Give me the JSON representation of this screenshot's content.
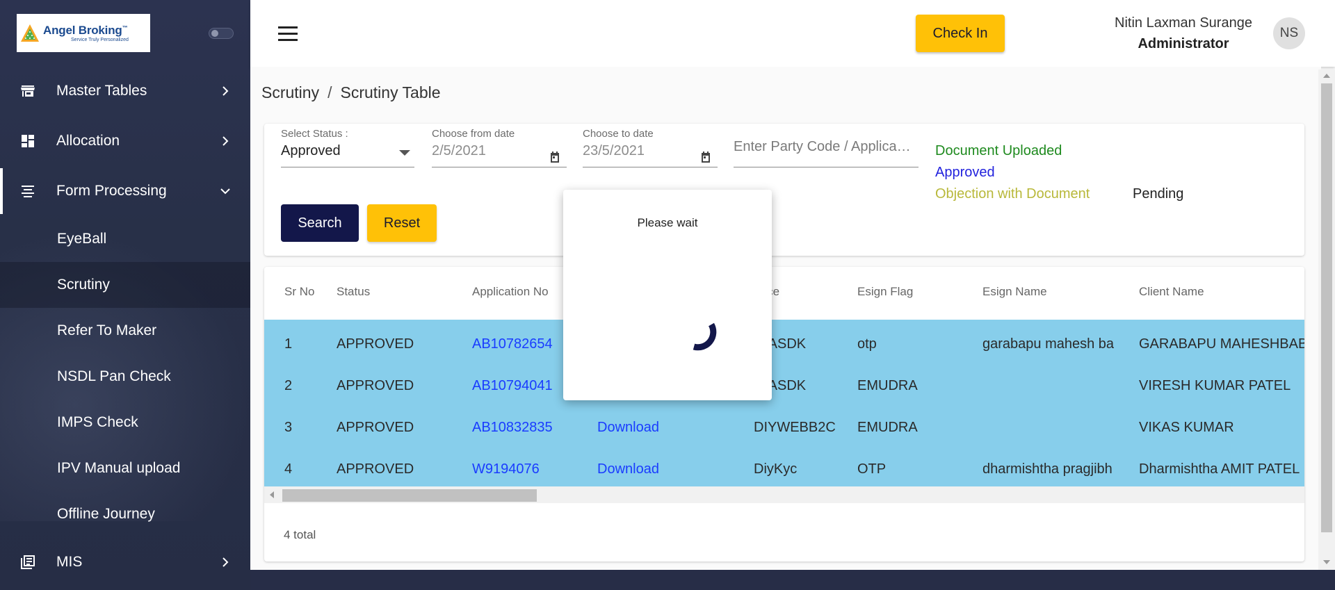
{
  "colors": {
    "sidebar_bg": "#283048",
    "accent_yellow": "#ffc107",
    "navy_button": "#13174a",
    "row_highlight": "#87ceeb",
    "link_blue": "#1a3cff",
    "legend_document_uploaded": "#1e8a1e",
    "legend_approved": "#2222dd",
    "legend_objection": "#b8b83a",
    "legend_pending": "#222222"
  },
  "brand": {
    "name": "Angel Broking",
    "tm": "™",
    "tagline": "Service Truly Personalized"
  },
  "sidebar": {
    "items": [
      {
        "label": "Master Tables",
        "icon": "store-icon",
        "chevron": "chevron-right-icon"
      },
      {
        "label": "Allocation",
        "icon": "dashboard-icon",
        "chevron": "chevron-right-icon"
      },
      {
        "label": "Form Processing",
        "icon": "subject-icon",
        "chevron": "chevron-down-icon"
      },
      {
        "label": "MIS",
        "icon": "library-books-icon",
        "chevron": "chevron-right-icon"
      }
    ],
    "subitems": [
      "EyeBall",
      "Scrutiny",
      "Refer To Maker",
      "NSDL Pan Check",
      "IMPS Check",
      "IPV Manual upload",
      "Offline Journey"
    ]
  },
  "header": {
    "checkin_label": "Check In",
    "user_name": "Nitin Laxman Surange",
    "user_role": "Administrator",
    "avatar_initials": "NS"
  },
  "breadcrumb": {
    "parent": "Scrutiny",
    "separator": "/",
    "current": "Scrutiny Table"
  },
  "filters": {
    "status_label": "Select Status :",
    "status_value": "Approved",
    "from_label": "Choose from date",
    "from_value": "2/5/2021",
    "to_label": "Choose to date",
    "to_value": "23/5/2021",
    "party_placeholder": "Enter Party Code / Applica…",
    "search_label": "Search",
    "reset_label": "Reset"
  },
  "legend": {
    "document_uploaded": "Document Uploaded",
    "approved": "Approved",
    "objection": "Objection with Document",
    "pending": "Pending"
  },
  "table": {
    "headers": [
      "Sr No",
      "Status",
      "Application No",
      "urce",
      "Esign Flag",
      "Esign Name",
      "Client Name"
    ],
    "rows": [
      {
        "sr": "1",
        "status": "APPROVED",
        "app_no": "AB10782654",
        "download": "",
        "source": "MASDK",
        "esign_flag": "otp",
        "esign_name": "garabapu mahesh ba",
        "client_name": "GARABAPU MAHESHBAB"
      },
      {
        "sr": "2",
        "status": "APPROVED",
        "app_no": "AB10794041",
        "download": "",
        "source": "MASDK",
        "esign_flag": "EMUDRA",
        "esign_name": "",
        "client_name": "VIRESH KUMAR PATEL"
      },
      {
        "sr": "3",
        "status": "APPROVED",
        "app_no": "AB10832835",
        "download": "Download",
        "source": "DIYWEBB2C",
        "esign_flag": "EMUDRA",
        "esign_name": "",
        "client_name": "VIKAS KUMAR"
      },
      {
        "sr": "4",
        "status": "APPROVED",
        "app_no": "W9194076",
        "download": "Download",
        "source": "DiyKyc",
        "esign_flag": "OTP",
        "esign_name": "dharmishtha pragjibh",
        "client_name": "Dharmishtha AMIT PATEL"
      }
    ],
    "total": "4 total"
  },
  "modal": {
    "title": "Please wait"
  }
}
